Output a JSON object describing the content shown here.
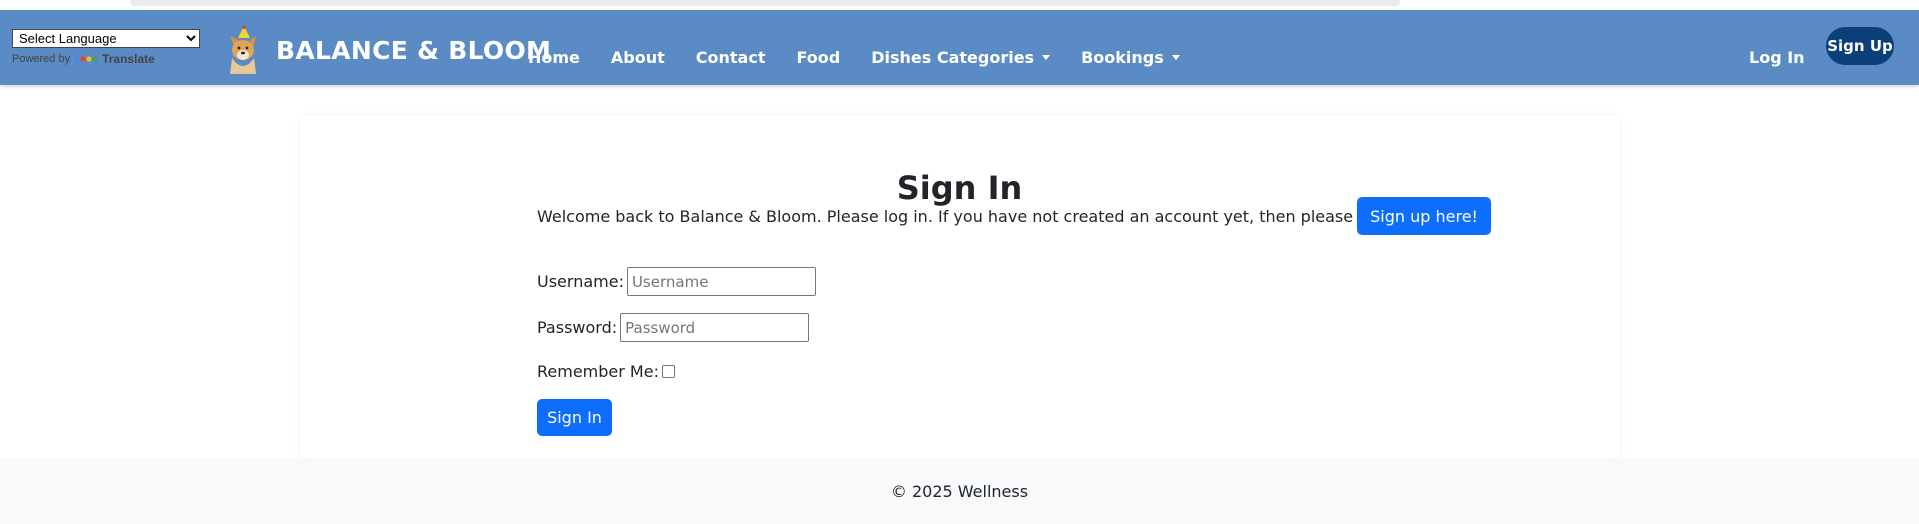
{
  "translate": {
    "select_value": "Select Language",
    "powered_by": "Powered by",
    "translate_label": "Translate"
  },
  "brand": {
    "name": "BALANCE & BLOOM",
    "logo_icon": "dog-with-party-hat-icon"
  },
  "nav": {
    "items": [
      {
        "label": "Home",
        "dropdown": false
      },
      {
        "label": "About",
        "dropdown": false
      },
      {
        "label": "Contact",
        "dropdown": false
      },
      {
        "label": "Food",
        "dropdown": false
      },
      {
        "label": "Dishes Categories",
        "dropdown": true
      },
      {
        "label": "Bookings",
        "dropdown": true
      }
    ],
    "login_label": "Log In",
    "signup_label": "Sign Up"
  },
  "page": {
    "title": "Sign In",
    "intro_text": "Welcome back to Balance & Bloom. Please log in. If you have not created an account yet, then please",
    "signup_here_label": "Sign up here!"
  },
  "form": {
    "username_label": "Username:",
    "username_placeholder": "Username",
    "username_value": "",
    "password_label": "Password:",
    "password_placeholder": "Password",
    "password_value": "",
    "remember_label": "Remember Me:",
    "submit_label": "Sign In"
  },
  "footer": {
    "text": "© 2025 Wellness"
  },
  "colors": {
    "navbar": "#5b8bc4",
    "signup_button": "#0b3f7a",
    "primary_button": "#0d6efd",
    "footer_bg": "#f8f9fa"
  }
}
